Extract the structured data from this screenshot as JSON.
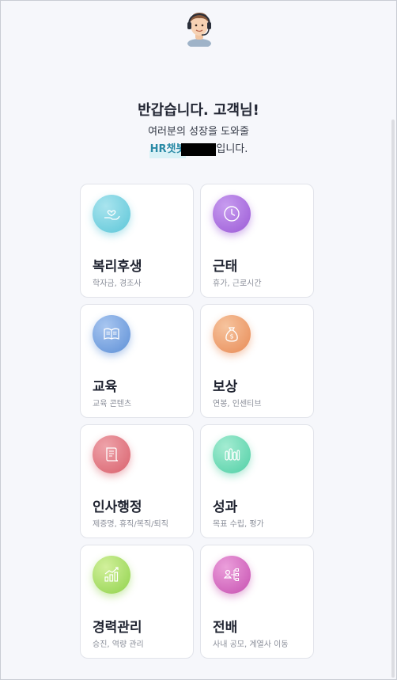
{
  "header": {
    "greeting": "반갑습니다. 고객님!",
    "line1": "여러분의 성장을 도와줄",
    "bot_name": "HR챗봇",
    "line2_suffix": "입니다."
  },
  "cards": [
    {
      "title": "복리후생",
      "subtitle": "학자금, 경조사",
      "icon": "heart-hand-icon",
      "color": "#5bc6d8"
    },
    {
      "title": "근태",
      "subtitle": "휴가, 근로시간",
      "icon": "clock-icon",
      "color": "#9b59d6"
    },
    {
      "title": "교육",
      "subtitle": "교육 콘텐츠",
      "icon": "book-icon",
      "color": "#5d8fd6"
    },
    {
      "title": "보상",
      "subtitle": "연봉, 인센티브",
      "icon": "money-bag-icon",
      "color": "#e88a55"
    },
    {
      "title": "인사행정",
      "subtitle": "제증명, 휴직/복직/퇴직",
      "icon": "document-icon",
      "color": "#d9606c"
    },
    {
      "title": "성과",
      "subtitle": "목표 수립, 평가",
      "icon": "bars-icon",
      "color": "#4fcfa5"
    },
    {
      "title": "경력관리",
      "subtitle": "승진, 역량 관리",
      "icon": "growth-chart-icon",
      "color": "#8fd24a"
    },
    {
      "title": "전배",
      "subtitle": "사내 공모, 계열사 이동",
      "icon": "org-chart-icon",
      "color": "#c64fb0"
    }
  ]
}
